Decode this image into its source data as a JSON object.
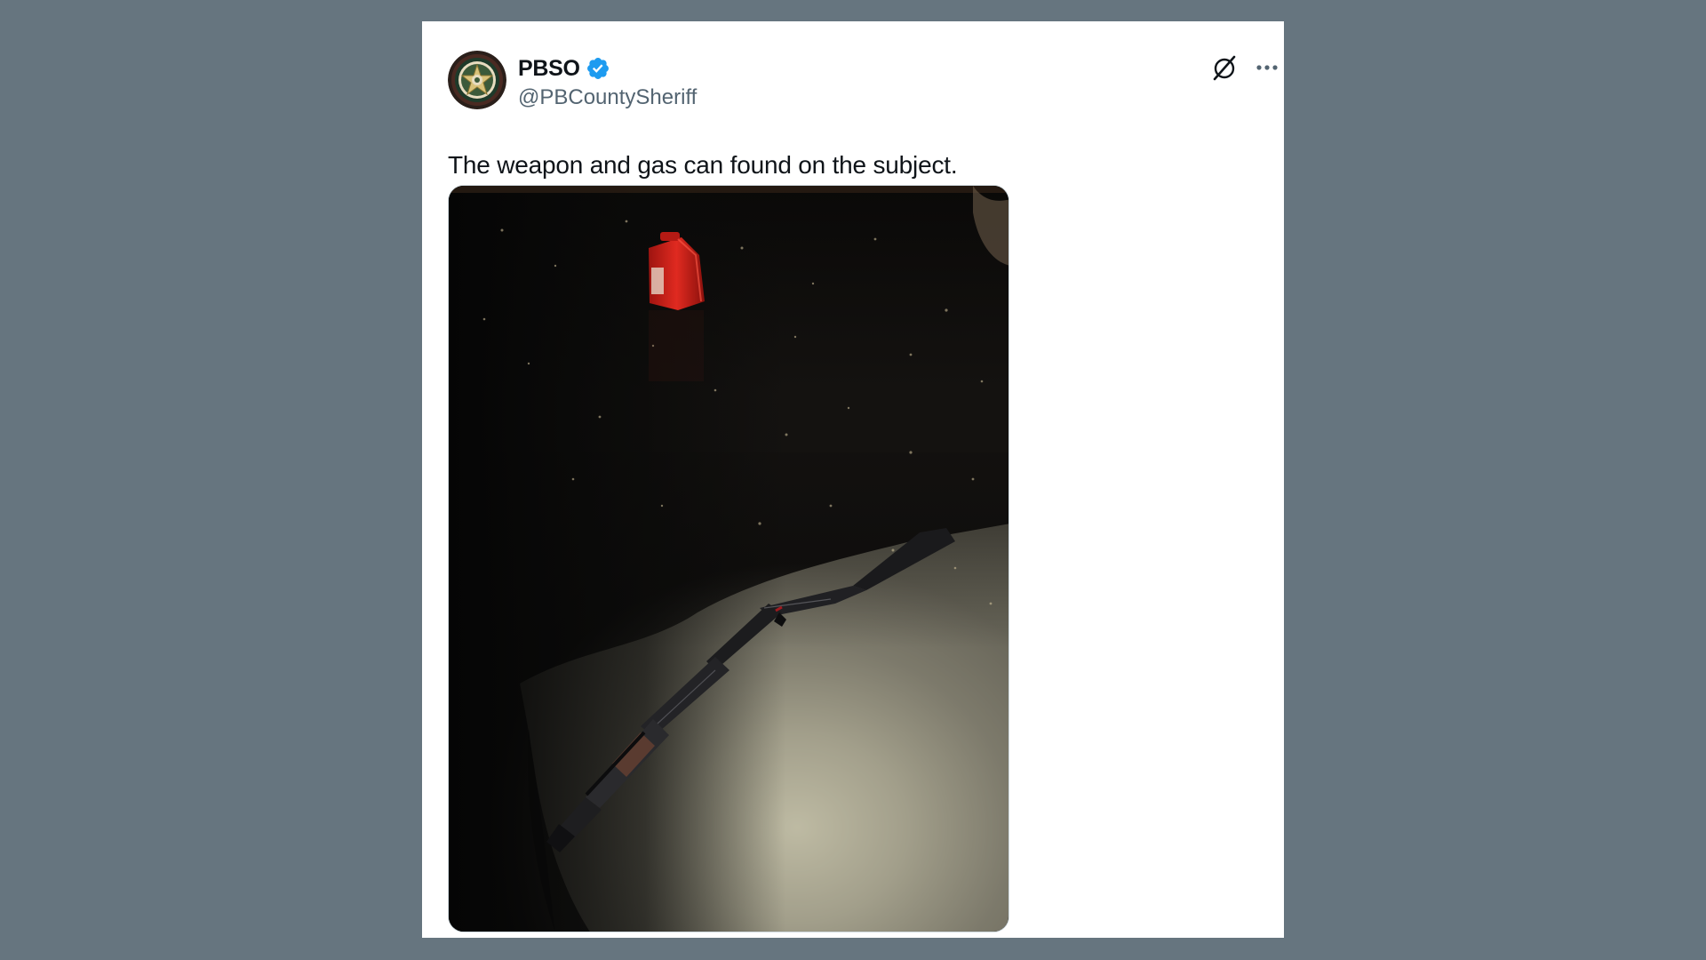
{
  "tweet": {
    "author": {
      "display_name": "PBSO",
      "handle": "@PBCountySheriff",
      "verified": true,
      "avatar_icon": "sheriff-badge-icon"
    },
    "text": "The weapon and gas can found on the subject.",
    "media_icon": "photo-shotgun-and-gas-can",
    "actions": {
      "grok_icon": "grok-icon",
      "more_icon": "more-horizontal-icon"
    }
  },
  "colors": {
    "page_background": "#66757f",
    "card_background": "#ffffff",
    "text_primary": "#0f1419",
    "text_secondary": "#536471",
    "verified_blue": "#1d9bf0"
  }
}
